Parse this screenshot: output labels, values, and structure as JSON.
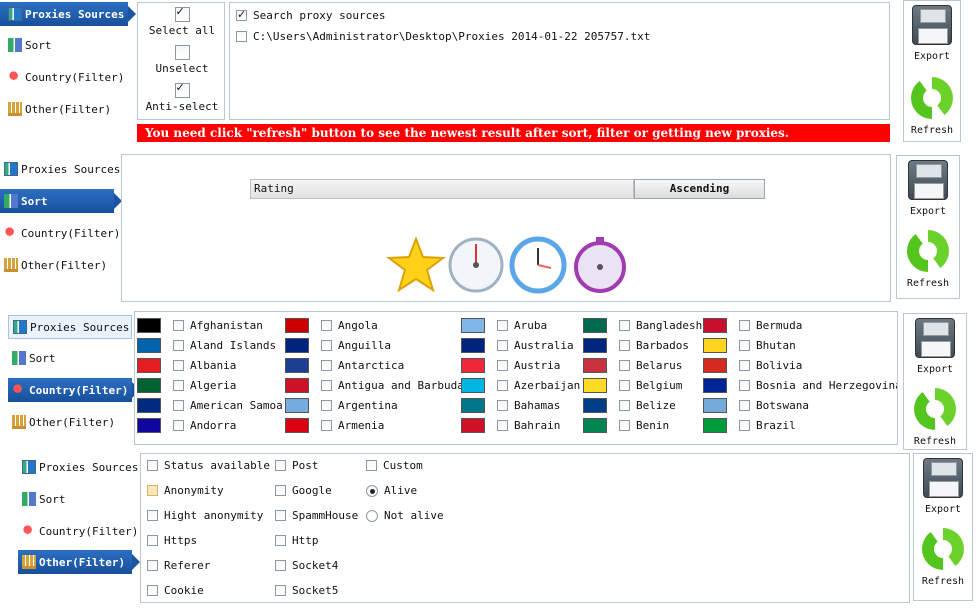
{
  "nav": {
    "proxies_sources": "Proxies Sources",
    "sort": "Sort",
    "country_filter": "Country(Filter)",
    "other_filter": "Other(Filter)"
  },
  "actions": {
    "export": "Export",
    "refresh": "Refresh"
  },
  "sources": {
    "select_all": "Select all",
    "unselect": "Unselect",
    "anti_select": "Anti-select",
    "search_label": "Search proxy sources",
    "file_path": "C:\\Users\\Administrator\\Desktop\\Proxies 2014-01-22 205757.txt",
    "warning": "You need click \"refresh\" button to see the newest result after sort, filter or getting new proxies."
  },
  "sort": {
    "field": "Rating",
    "order": "Ascending"
  },
  "countries": [
    [
      "Afghanistan",
      "Angola",
      "Aruba",
      "Bangladesh",
      "Bermuda"
    ],
    [
      "Aland Islands",
      "Anguilla",
      "Australia",
      "Barbados",
      "Bhutan"
    ],
    [
      "Albania",
      "Antarctica",
      "Austria",
      "Belarus",
      "Bolivia"
    ],
    [
      "Algeria",
      "Antigua and Barbuda",
      "Azerbaijan",
      "Belgium",
      "Bosnia and Herzegovina"
    ],
    [
      "American Samoa",
      "Argentina",
      "Bahamas",
      "Belize",
      "Botswana"
    ],
    [
      "Andorra",
      "Armenia",
      "Bahrain",
      "Benin",
      "Brazil"
    ]
  ],
  "flag_colors": {
    "Afghanistan": "#000000",
    "Angola": "#cc0000",
    "Aruba": "#7fb8e8",
    "Bangladesh": "#006a4e",
    "Bermuda": "#c8102e",
    "Aland Islands": "#0064ad",
    "Anguilla": "#00247d",
    "Australia": "#00247d",
    "Barbados": "#00267f",
    "Bhutan": "#ffd520",
    "Albania": "#e41e20",
    "Antarctica": "#1c3f94",
    "Austria": "#ed2939",
    "Belarus": "#c8313e",
    "Bolivia": "#d52b1e",
    "Algeria": "#006233",
    "Antigua and Barbuda": "#ce1126",
    "Azerbaijan": "#00b5e2",
    "Belgium": "#fdda24",
    "Bosnia and Herzegovina": "#002395",
    "American Samoa": "#002b7f",
    "Argentina": "#74acdf",
    "Bahamas": "#00778b",
    "Belize": "#003f87",
    "Botswana": "#75aadb",
    "Andorra": "#10069f",
    "Armenia": "#d90012",
    "Bahrain": "#ce1126",
    "Benin": "#008751",
    "Brazil": "#009c3b"
  },
  "other": {
    "status_available": "Status available",
    "anonymity": "Anonymity",
    "high_anonymity": "Hight anonymity",
    "https": "Https",
    "referer": "Referer",
    "cookie": "Cookie",
    "post": "Post",
    "google": "Google",
    "spamhouse": "SpammHouse",
    "http": "Http",
    "socket4": "Socket4",
    "socket5": "Socket5",
    "custom": "Custom",
    "alive": "Alive",
    "not_alive": "Not alive"
  }
}
